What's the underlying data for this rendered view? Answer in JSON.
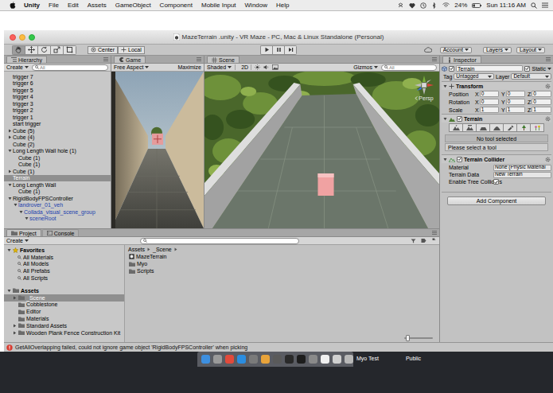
{
  "menubar": {
    "app": "Unity",
    "items": [
      "File",
      "Edit",
      "Assets",
      "GameObject",
      "Component",
      "Mobile Input",
      "Window",
      "Help"
    ],
    "battery": "24%",
    "clock": "Sun 11:16 AM"
  },
  "window": {
    "title": "MazeTerrain .unity - VR Maze - PC, Mac & Linux Standalone (Personal)"
  },
  "toolbar": {
    "tools": [
      {
        "selected": true
      },
      {
        "selected": false
      },
      {
        "selected": false
      },
      {
        "selected": false
      },
      {
        "selected": false
      }
    ],
    "pivot": "Center",
    "space": "Local",
    "account": "Account",
    "layers": "Layers",
    "layout": "Layout"
  },
  "hierarchy": {
    "title": "Hierarchy",
    "create": "Create",
    "search": "All",
    "items": [
      {
        "label": "trigger 7",
        "depth": 0,
        "selected": false,
        "color": "#000000"
      },
      {
        "label": "trigger 6",
        "depth": 0,
        "selected": false,
        "color": "#000000"
      },
      {
        "label": "trigger 5",
        "depth": 0,
        "selected": false,
        "color": "#000000"
      },
      {
        "label": "trigger 4",
        "depth": 0,
        "selected": false,
        "color": "#000000"
      },
      {
        "label": "trigger 3",
        "depth": 0,
        "selected": false,
        "color": "#000000"
      },
      {
        "label": "trigger 2",
        "depth": 0,
        "selected": false,
        "color": "#000000"
      },
      {
        "label": "trigger 1",
        "depth": 0,
        "selected": false,
        "color": "#000000"
      },
      {
        "label": "start trigger",
        "depth": 0,
        "selected": false,
        "color": "#000000"
      },
      {
        "label": "Cube (5)",
        "depth": 0,
        "expanded": false,
        "selected": false,
        "color": "#000000"
      },
      {
        "label": "Cube (4)",
        "depth": 0,
        "expanded": false,
        "selected": false,
        "color": "#000000"
      },
      {
        "label": "Cube (2)",
        "depth": 0,
        "selected": false,
        "color": "#000000"
      },
      {
        "label": "Long Length Wall hole (1)",
        "depth": 0,
        "expanded": true,
        "selected": false,
        "color": "#000000"
      },
      {
        "label": "Cube (1)",
        "depth": 1,
        "selected": false,
        "color": "#000000"
      },
      {
        "label": "Cube (1)",
        "depth": 1,
        "selected": false,
        "color": "#000000"
      },
      {
        "label": "Cube (1)",
        "depth": 0,
        "expanded": false,
        "selected": false,
        "color": "#000000"
      },
      {
        "label": "Terrain",
        "depth": 0,
        "selected": true,
        "color": "#000000"
      },
      {
        "label": "Long Length Wall",
        "depth": 0,
        "expanded": true,
        "selected": false,
        "color": "#000000"
      },
      {
        "label": "Cube (1)",
        "depth": 1,
        "selected": false,
        "color": "#000000"
      },
      {
        "label": "RigidBodyFPSController",
        "depth": 0,
        "expanded": true,
        "selected": false,
        "color": "#000000"
      },
      {
        "label": "landrover_01_veh",
        "depth": 1,
        "expanded": true,
        "selected": false,
        "color": "#1c3fae"
      },
      {
        "label": "Collada_visual_scene_group",
        "depth": 2,
        "expanded": true,
        "selected": false,
        "color": "#1c3fae"
      },
      {
        "label": "sceneRoot",
        "depth": 3,
        "expanded": true,
        "selected": false,
        "color": "#1c3fae"
      }
    ]
  },
  "game": {
    "title": "Game",
    "aspect": "Free Aspect",
    "maximize": "Maximize"
  },
  "scene": {
    "title": "Scene",
    "shading": "Shaded",
    "mode": "2D",
    "gizmos": "Gizmos",
    "search": "All",
    "projection": "Persp"
  },
  "inspector": {
    "title": "Inspector",
    "object": {
      "name": "Terrain",
      "active": true,
      "static_label": "Static",
      "static": true,
      "tag_label": "Tag",
      "tag": "Untagged",
      "layer_label": "Layer",
      "layer": "Default"
    },
    "transform": {
      "title": "Transform",
      "expanded": true,
      "rows": [
        {
          "label": "Position",
          "values": [
            {
              "axis": "X",
              "value": "0"
            },
            {
              "axis": "Y",
              "value": "0"
            },
            {
              "axis": "Z",
              "value": "0"
            }
          ]
        },
        {
          "label": "Rotation",
          "values": [
            {
              "axis": "X",
              "value": "0"
            },
            {
              "axis": "Y",
              "value": "0"
            },
            {
              "axis": "Z",
              "value": "0"
            }
          ]
        },
        {
          "label": "Scale",
          "values": [
            {
              "axis": "X",
              "value": "1"
            },
            {
              "axis": "Y",
              "value": "1"
            },
            {
              "axis": "Z",
              "value": "1"
            }
          ]
        }
      ]
    },
    "terrain": {
      "title": "Terrain",
      "expanded": true,
      "enabled": true,
      "tools": [
        {
          "selected": false
        },
        {
          "selected": false
        },
        {
          "selected": false
        },
        {
          "selected": false
        },
        {
          "selected": false
        },
        {
          "selected": false
        },
        {
          "selected": false
        }
      ],
      "message": "No tool selected",
      "hint": "Please select a tool"
    },
    "collider": {
      "title": "Terrain Collider",
      "expanded": true,
      "enabled": true,
      "fields": [
        {
          "label": "Material",
          "value": "None (Physic Material"
        },
        {
          "label": "Terrain Data",
          "value": "New Terrain"
        }
      ],
      "tree_label": "Enable Tree Colliders",
      "tree": true
    },
    "add_component": "Add Component"
  },
  "project": {
    "tabs": [
      {
        "label": "Project",
        "selected": true
      },
      {
        "label": "Console",
        "selected": false
      }
    ],
    "create": "Create",
    "favorites": {
      "label": "Favorites",
      "expanded": true,
      "items": [
        "All Materials",
        "All Models",
        "All Prefabs",
        "All Scripts"
      ]
    },
    "assets": {
      "label": "Assets",
      "expanded": true,
      "items": [
        {
          "label": "_Scene",
          "expanded": false,
          "selected": true
        },
        {
          "label": "Cobblestone",
          "selected": false
        },
        {
          "label": "Editor",
          "selected": false
        },
        {
          "label": "Materials",
          "selected": false
        },
        {
          "label": "Standard Assets",
          "expanded": false,
          "selected": false
        },
        {
          "label": "Wooden Plank Fence Construction Kit",
          "expanded": false,
          "selected": false
        }
      ]
    },
    "breadcrumb": [
      "Assets",
      "_Scene"
    ],
    "files": [
      {
        "label": "MazeTerrain",
        "kind": "scene"
      },
      {
        "label": "Myo",
        "kind": "folder"
      },
      {
        "label": "Scripts",
        "kind": "folder"
      }
    ],
    "zoom": {
      "level": 0.05
    }
  },
  "status_bar": {
    "message": "GetAllOverlapping failed, could not ignore game object 'RigidBodyFPSController' when picking"
  },
  "dock": {
    "labels": [
      "Myo Test",
      "Public"
    ]
  }
}
